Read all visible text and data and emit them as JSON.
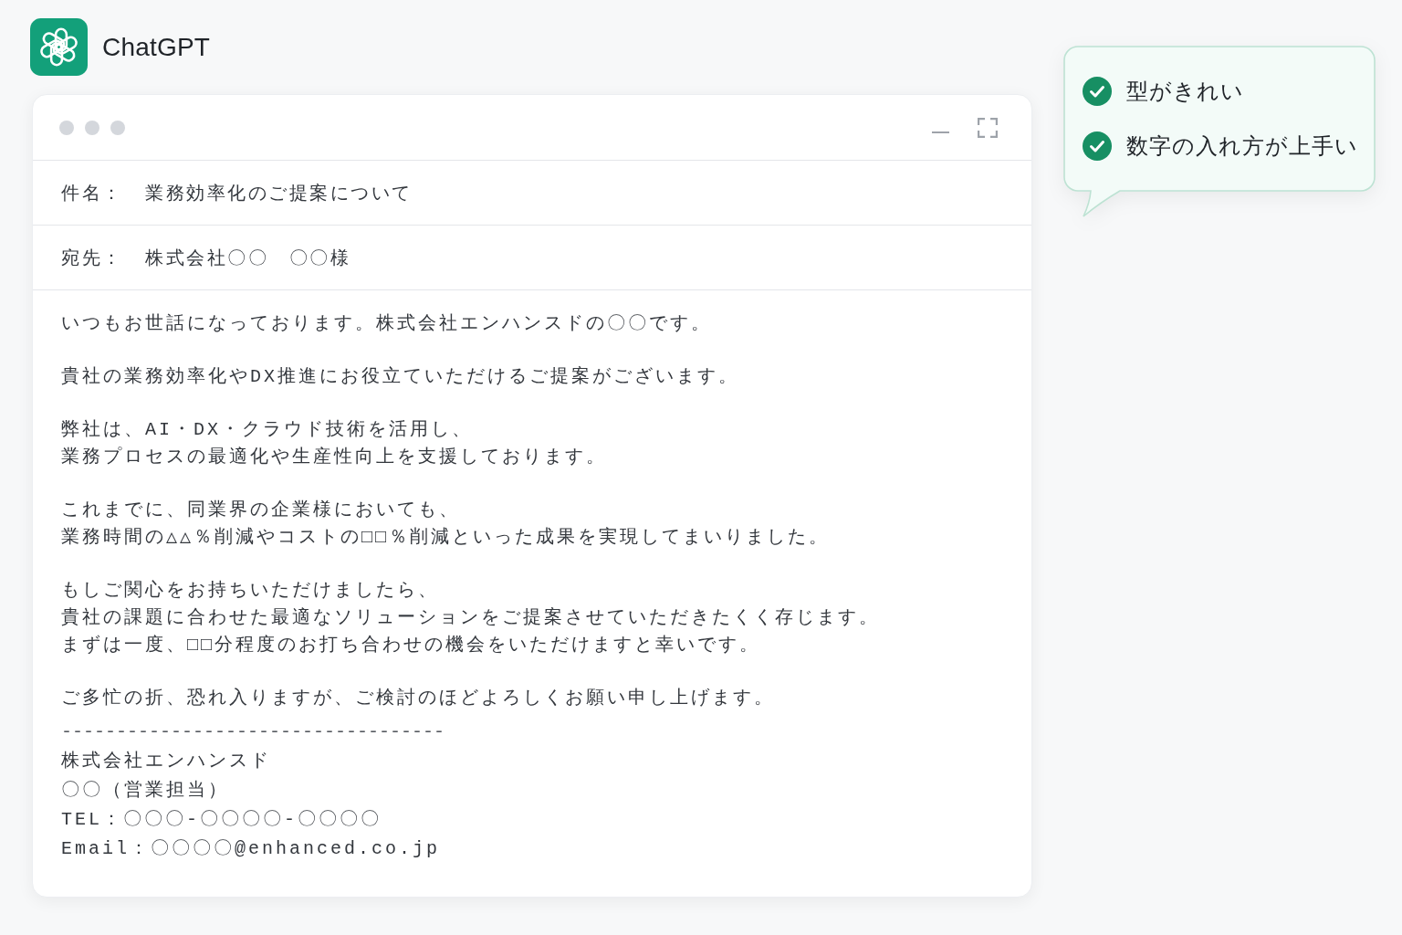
{
  "app": {
    "name": "ChatGPT"
  },
  "email": {
    "fields": [
      {
        "label": "件名：",
        "value": "業務効率化のご提案について"
      },
      {
        "label": "宛先：",
        "value": "株式会社〇〇　〇〇様"
      }
    ],
    "body": [
      {
        "lines": [
          "いつもお世話になっております。株式会社エンハンスドの〇〇です。"
        ]
      },
      {
        "lines": [
          "貴社の業務効率化やDX推進にお役立ていただけるご提案がございます。"
        ]
      },
      {
        "lines": [
          "弊社は、AI・DX・クラウド技術を活用し、",
          "業務プロセスの最適化や生産性向上を支援しております。"
        ]
      },
      {
        "lines": [
          "これまでに、同業界の企業様においても、",
          "業務時間の△△％削減やコストの□□％削減といった成果を実現してまいりました。"
        ]
      },
      {
        "lines": [
          "もしご関心をお持ちいただけましたら、",
          "貴社の課題に合わせた最適なソリューションをご提案させていただきたくく存じます。",
          "まずは一度、□□分程度のお打ち合わせの機会をいただけますと幸いです。"
        ]
      },
      {
        "lines": [
          "ご多忙の折、恐れ入りますが、ご検討のほどよろしくお願い申し上げます。"
        ]
      }
    ],
    "signature": {
      "divider": "-----------------------------------",
      "lines": [
        "株式会社エンハンスド",
        "〇〇（営業担当）",
        "TEL：〇〇〇-〇〇〇〇-〇〇〇〇",
        "Email：〇〇〇〇@enhanced.co.jp"
      ]
    }
  },
  "callout": {
    "items": [
      {
        "text": "型がきれい",
        "checked": true
      },
      {
        "text": "数字の入れ方が上手い",
        "checked": true
      }
    ]
  }
}
